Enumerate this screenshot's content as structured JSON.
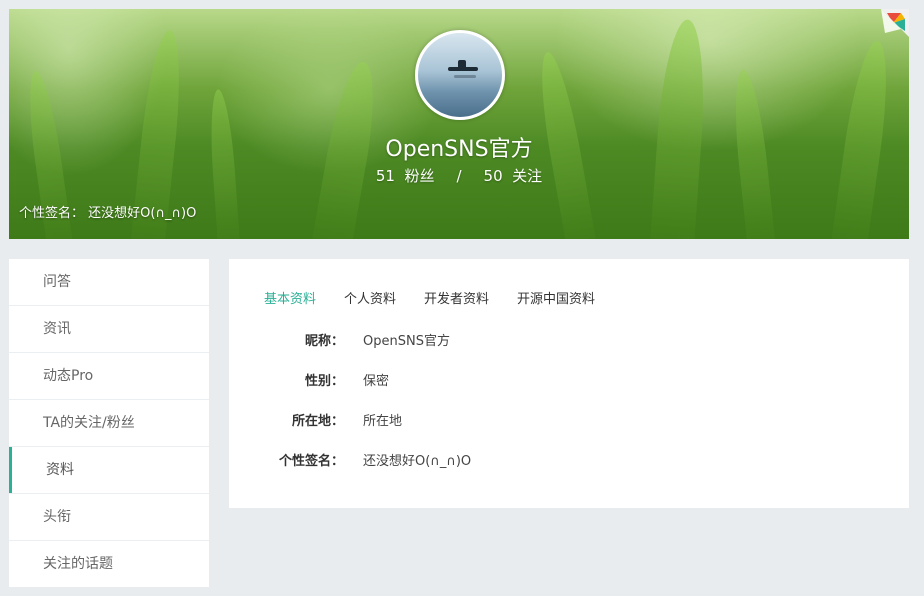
{
  "profile": {
    "username": "OpenSNS官方",
    "fans_count": "51",
    "fans_label": "粉丝",
    "follow_count": "50",
    "follow_label": "关注",
    "separator": "/",
    "signature_label": "个性签名：",
    "signature": "还没想好O(∩_∩)O"
  },
  "sidebar": {
    "items": [
      {
        "label": "问答"
      },
      {
        "label": "资讯"
      },
      {
        "label": "动态Pro"
      },
      {
        "label": "TA的关注/粉丝"
      },
      {
        "label": "资料"
      },
      {
        "label": "头衔"
      },
      {
        "label": "关注的话题"
      }
    ],
    "active_index": 4
  },
  "tabs": [
    {
      "label": "基本资料"
    },
    {
      "label": "个人资料"
    },
    {
      "label": "开发者资料"
    },
    {
      "label": "开源中国资料"
    }
  ],
  "fields": [
    {
      "label": "昵称：",
      "value": "OpenSNS官方"
    },
    {
      "label": "性别：",
      "value": "保密"
    },
    {
      "label": "所在地：",
      "value": "所在地"
    },
    {
      "label": "个性签名：",
      "value": "还没想好O(∩_∩)O"
    }
  ],
  "colors": {
    "accent": "#2bb096",
    "page_background": "#e9ecef"
  }
}
